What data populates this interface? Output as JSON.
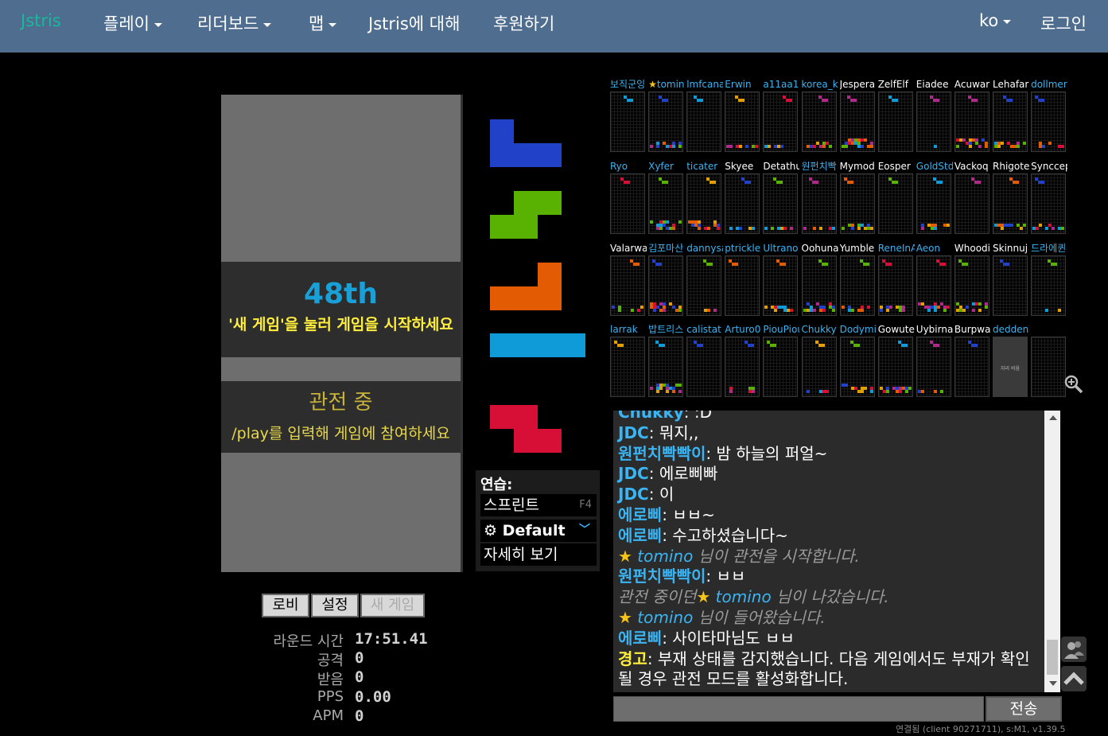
{
  "nav": {
    "brand": "Jstris",
    "play": "플레이",
    "leaderboard": "리더보드",
    "maps": "맵",
    "about": "Jstris에 대해",
    "donate": "후원하기",
    "lang": "ko",
    "login": "로그인"
  },
  "board": {
    "place": "48th",
    "start_hint": "'새 게임'을 눌러 게임을 시작하세요",
    "spectating": "관전 중",
    "join_hint": "/play를 입력해 게임에 참여하세요"
  },
  "buttons": {
    "lobby": "로비",
    "settings": "설정",
    "new_game": "새 게임"
  },
  "stats": [
    {
      "label": "라운드 시간",
      "value": "17:51.41"
    },
    {
      "label": "공격",
      "value": "0"
    },
    {
      "label": "받음",
      "value": "0"
    },
    {
      "label": "PPS",
      "value": "0.00"
    },
    {
      "label": "APM",
      "value": "0"
    }
  ],
  "queue": [
    {
      "piece": "J",
      "color": "#2141c9"
    },
    {
      "piece": "S",
      "color": "#59b101"
    },
    {
      "piece": "L",
      "color": "#e35b02"
    },
    {
      "piece": "I",
      "color": "#0f9bd7"
    },
    {
      "piece": "Z",
      "color": "#d70f37"
    }
  ],
  "practice": {
    "title": "연습:",
    "sprint": "스프린트",
    "sprint_key": "F4",
    "preset": "Default",
    "more": "자세히 보기"
  },
  "players": [
    [
      "보직군잉",
      "tomino",
      "lmfcana",
      "Erwin",
      "a11aa1",
      "korea_k",
      "Jespera",
      "ZelfElf",
      "Eiadee",
      "Acuwar",
      "Lehafar",
      "dollmer"
    ],
    [
      "Ryo",
      "Xyfer",
      "ticater",
      "Skyee",
      "Detathu",
      "원펀치빡",
      "Mymod",
      "Eosper",
      "GoldStd",
      "Vackoq",
      "Rhigote",
      "Synccep"
    ],
    [
      "Valarwa",
      "김포마산",
      "dannysa",
      "ptrickle",
      "Ultrano",
      "Oohuna",
      "Yumble",
      "ReneInA",
      "Aeon",
      "Whoodi",
      "Skinnuj",
      "드라에퀸"
    ],
    [
      "larrak",
      "밥트리스",
      "calistat",
      "Arturo0",
      "PiouPiou",
      "Chukky",
      "Dodymi",
      "Gowute",
      "Uybirna",
      "Burpwa",
      "dedden",
      ""
    ]
  ],
  "player_colors": {
    "highlight": "#3ab4f2",
    "normal": "#ffffff"
  },
  "chat": [
    {
      "user": "Chukky",
      "text": ": :D"
    },
    {
      "user": "JDC",
      "text": ": 뭐지,,"
    },
    {
      "user": "원펀치빡빡이",
      "text": ": 밤 하늘의 퍼얼~"
    },
    {
      "user": "JDC",
      "text": ": 에로삐빠"
    },
    {
      "user": "JDC",
      "text": ": 이"
    },
    {
      "user": "에로삐",
      "text": ": ㅂㅂ~"
    },
    {
      "user": "에로삐",
      "text": ": 수고하셨습니다~"
    },
    {
      "sys_pre": "",
      "star_user": "tomino",
      "sys": " 님이 관전을 시작합니다."
    },
    {
      "user": "원펀치빡빡이",
      "text": ": ㅂㅂ"
    },
    {
      "sys_pre": "관전 중이던",
      "star_user": "tomino",
      "sys": " 님이 나갔습니다."
    },
    {
      "sys_pre": "",
      "star_user": "tomino",
      "sys": " 님이 들어왔습니다."
    },
    {
      "user": "에로삐",
      "text": ": 사이타마님도 ㅂㅂ"
    },
    {
      "warn_user": "경고",
      "text": ": 부재 상태를 감지했습니다. 다음 게임에서도 부재가 확인될 경우 관전 모드를 활성화합니다."
    }
  ],
  "chat_send": "전송",
  "footer": "연결됨 (client 90271711), s:M1, v1.39.5",
  "spectator_small_text": "자리 비움",
  "spectator_place": "48th"
}
